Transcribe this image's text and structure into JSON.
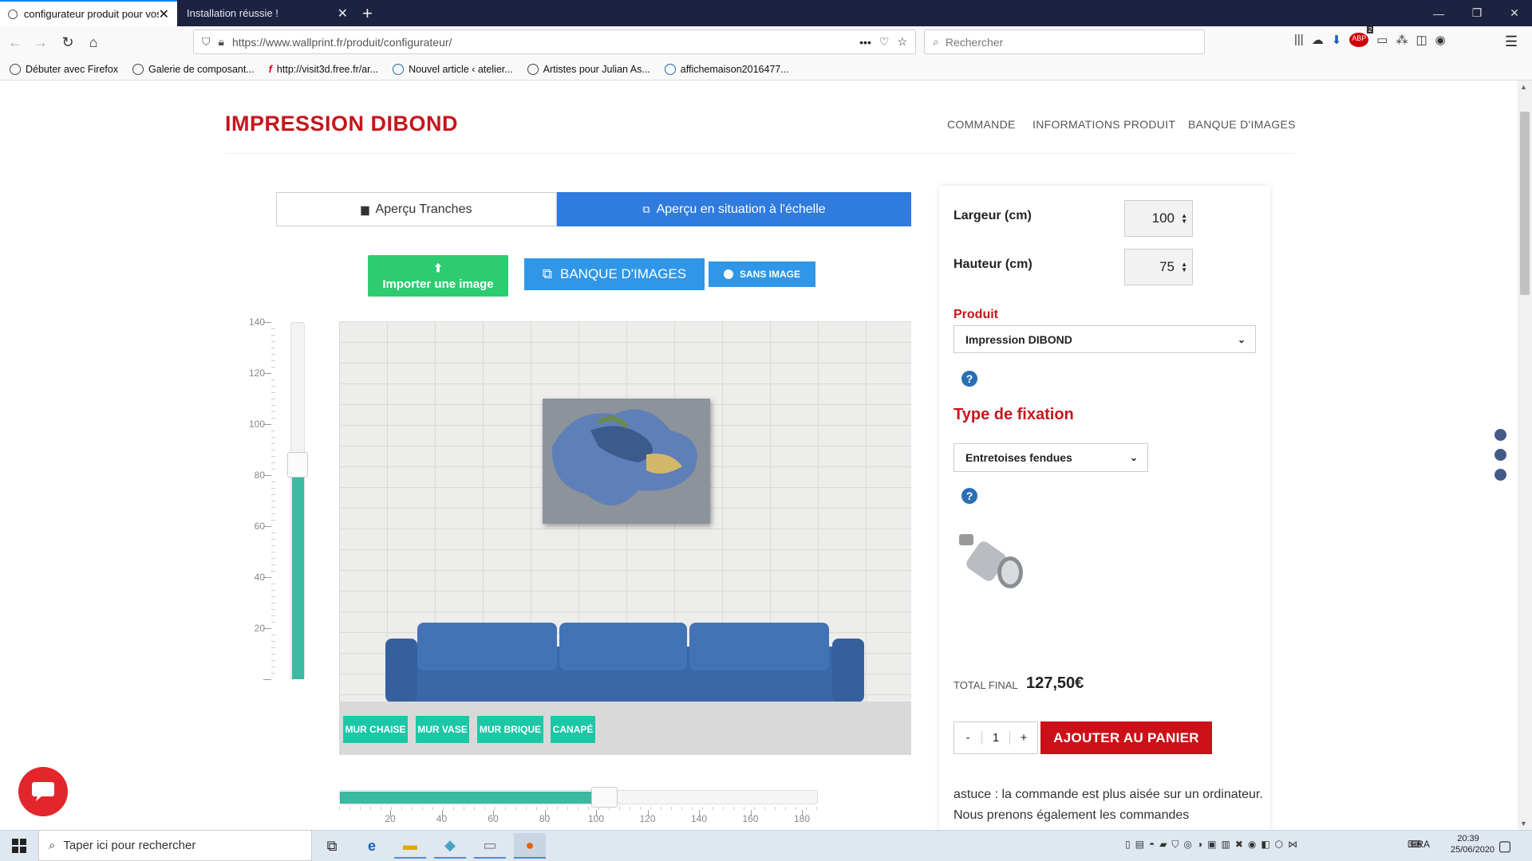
{
  "browser": {
    "tabs": [
      {
        "title": "configurateur produit pour vos",
        "active": true
      },
      {
        "title": "Installation réussie !",
        "active": false
      }
    ],
    "url": "https://www.wallprint.fr/produit/configurateur/",
    "search_placeholder": "Rechercher",
    "bookmarks": [
      "Débuter avec Firefox",
      "Galerie de composant...",
      "http://visit3d.free.fr/ar...",
      "Nouvel article ‹ atelier...",
      "Artistes pour Julian As...",
      "affichemaison2016477..."
    ],
    "abp_badge": "2"
  },
  "site": {
    "brand": "IMPRESSION DIBOND",
    "menu": [
      "COMMANDE",
      "INFORMATIONS PRODUIT",
      "BANQUE D'IMAGES"
    ]
  },
  "preview": {
    "tab_slices": "Aperçu Tranches",
    "tab_situation": "Aperçu en situation à l'échelle",
    "import_label": "Importer une image",
    "bank_label": "BANQUE D'IMAGES",
    "no_image_label": "SANS IMAGE",
    "scenes": [
      "MUR CHAISE",
      "MUR VASE",
      "MUR BRIQUE",
      "CANAPÉ"
    ],
    "vertical_scale": [
      "140",
      "120",
      "100",
      "80",
      "60",
      "40",
      "20"
    ],
    "vertical_level_percent": 60,
    "horizontal_scale": [
      "20",
      "40",
      "60",
      "80",
      "100",
      "120",
      "140",
      "160",
      "180"
    ],
    "horizontal_level_percent": 55
  },
  "config": {
    "width_label": "Largeur (cm)",
    "width_value": "100",
    "height_label": "Hauteur (cm)",
    "height_value": "75",
    "product_label": "Produit",
    "product_value": "Impression DIBOND",
    "fixation_label": "Type de fixation",
    "fixation_value": "Entretoises fendues",
    "total_label": "TOTAL FINAL",
    "total_value": "127,50€",
    "qty_minus": "-",
    "qty_value": "1",
    "qty_plus": "+",
    "add_to_cart": "AJOUTER AU PANIER",
    "tip": "astuce : la commande est plus aisée sur un ordinateur. Nous prenons également les commandes"
  },
  "taskbar": {
    "search_placeholder": "Taper ici pour rechercher",
    "lang": "FRA",
    "time": "20:39",
    "date": "25/06/2020"
  },
  "colors": {
    "brand_red": "#c4161c",
    "accent_blue": "#2f7bde",
    "teal": "#3bb9a2",
    "green": "#2ecc71"
  }
}
